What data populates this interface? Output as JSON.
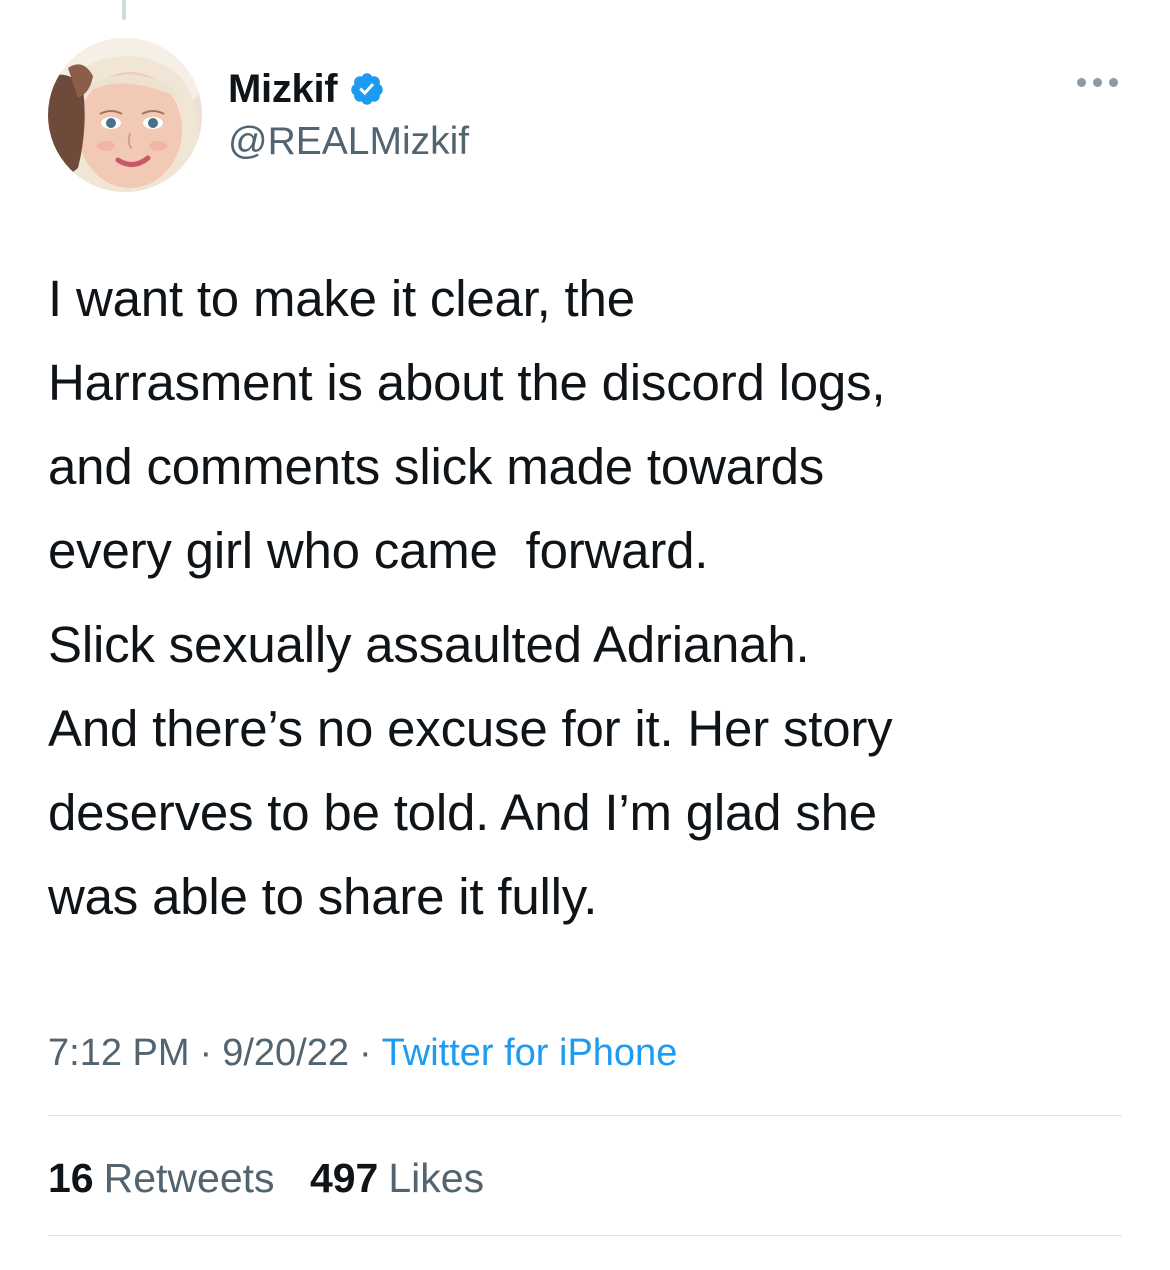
{
  "user": {
    "display_name": "Mizkif",
    "handle": "@REALMizkif",
    "verified": true
  },
  "tweet": {
    "paragraphs": [
      "I want to make it clear, the\nHarrasment is about the discord logs,\nand comments slick made towards\nevery girl who came  forward.",
      "Slick sexually assaulted Adrianah.\nAnd there’s no excuse for it. Her story\ndeserves to be told. And I’m glad she\nwas able to share it fully."
    ]
  },
  "meta": {
    "time": "7:12 PM",
    "separator": "·",
    "date": "9/20/22",
    "source": "Twitter for iPhone"
  },
  "stats": {
    "retweets_count": "16",
    "retweets_label": "Retweets",
    "likes_count": "497",
    "likes_label": "Likes"
  },
  "colors": {
    "text": "#0f1419",
    "secondary": "#536471",
    "link": "#1d9bf0",
    "verified_badge": "#1d9bf0",
    "divider": "#dfe5e8"
  },
  "icons": {
    "verified": "verified-badge-icon",
    "more": "more-options-icon"
  }
}
